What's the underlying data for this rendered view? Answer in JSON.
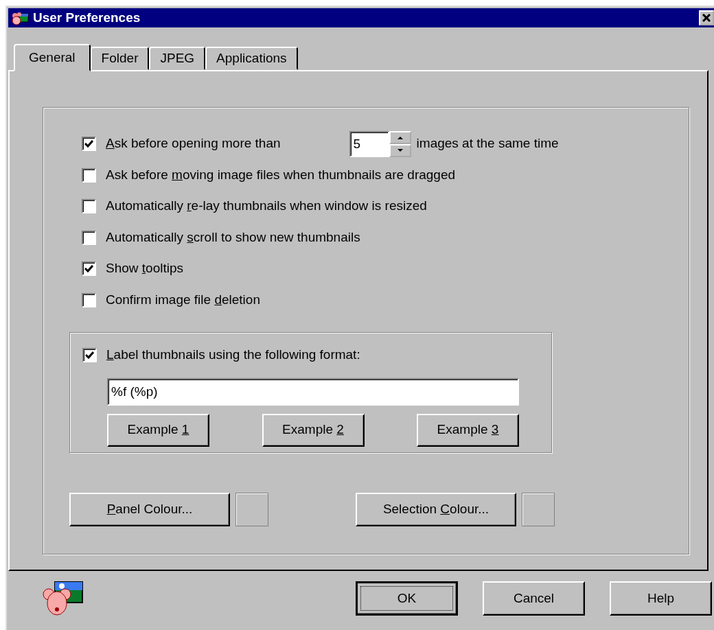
{
  "window": {
    "title": "User Preferences"
  },
  "tabs": [
    {
      "label": "General",
      "selected": true
    },
    {
      "label": "Folder",
      "selected": false
    },
    {
      "label": "JPEG",
      "selected": false
    },
    {
      "label": "Applications",
      "selected": false
    }
  ],
  "options": [
    {
      "kind": "spin",
      "checked": true,
      "access_key": "A",
      "label_end": "sk before opening more than",
      "spin_value": "5",
      "suffix": "images at the same time"
    },
    {
      "kind": "check",
      "checked": false,
      "label_start": "Ask before ",
      "access_key": "m",
      "label_end": "oving image files when thumbnails are dragged"
    },
    {
      "kind": "check",
      "checked": false,
      "label_start": "Automatically ",
      "access_key": "r",
      "label_end": "e-lay thumbnails when window is resized"
    },
    {
      "kind": "check",
      "checked": false,
      "label_start": "Automatically ",
      "access_key": "s",
      "label_end": "croll to show new thumbnails"
    },
    {
      "kind": "check",
      "checked": true,
      "label_start": "Show ",
      "access_key": "t",
      "label_end": "ooltips"
    },
    {
      "kind": "check",
      "checked": false,
      "label_start": "Confirm image file ",
      "access_key": "d",
      "label_end": "eletion"
    }
  ],
  "label_format": {
    "checked": true,
    "access_key": "L",
    "label_end": "abel thumbnails using the following format:",
    "value": "%f (%p)",
    "examples": [
      {
        "label_start": "Example ",
        "access_key": "1"
      },
      {
        "label_start": "Example ",
        "access_key": "2"
      },
      {
        "label_start": "Example ",
        "access_key": "3"
      }
    ]
  },
  "colour_buttons": [
    {
      "access_key": "P",
      "label_end": "anel Colour..."
    },
    {
      "label_start": "Selection ",
      "access_key": "C",
      "label_end": "olour..."
    }
  ],
  "buttons": [
    {
      "label": "OK",
      "default": true
    },
    {
      "label": "Cancel",
      "default": false
    },
    {
      "label": "Help",
      "default": false
    }
  ]
}
